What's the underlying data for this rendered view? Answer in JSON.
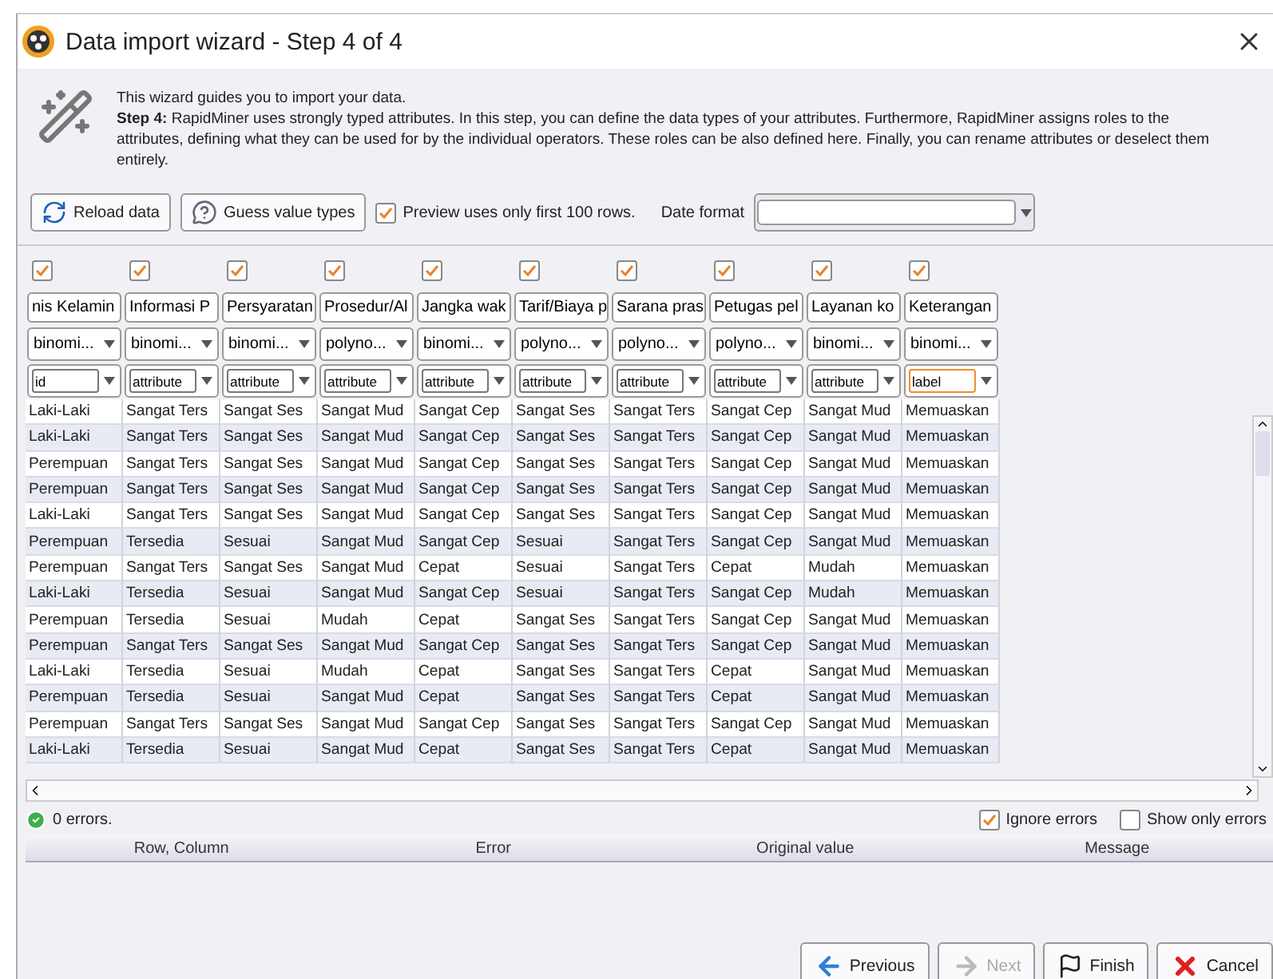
{
  "window": {
    "title": "Data import wizard - Step 4 of 4"
  },
  "intro": [
    "This wizard guides you to import your data.",
    "**Step 4:** RapidMiner uses strongly typed attributes. In this step, you can define the data types of your attributes. Furthermore, RapidMiner assigns roles to the attributes, defining what they can be used for by the individual operators. These roles can be also defined here. Finally, you can rename attributes or deselect them entirely."
  ],
  "toolbar": {
    "buttons": [
      {
        "label": "Reload data",
        "kind": "reload"
      },
      {
        "label": "Guess value types",
        "kind": "guess"
      }
    ],
    "preview": {
      "label": "Preview uses only first 100 rows.",
      "checked": true
    },
    "date_format": {
      "label": "Date format"
    }
  },
  "columns": [
    {
      "checked": true,
      "name": "nis Kelamin",
      "type": "binomi...",
      "role": "id",
      "focused": false
    },
    {
      "checked": true,
      "name": "Informasi  P",
      "type": "binomi...",
      "role": "attribute",
      "focused": false
    },
    {
      "checked": true,
      "name": "Persyaratan",
      "type": "binomi...",
      "role": "attribute",
      "focused": false
    },
    {
      "checked": true,
      "name": "Prosedur/Al",
      "type": "polyno...",
      "role": "attribute",
      "focused": false
    },
    {
      "checked": true,
      "name": "Jangka wak",
      "type": "binomi...",
      "role": "attribute",
      "focused": false
    },
    {
      "checked": true,
      "name": "Tarif/Biaya p",
      "type": "polyno...",
      "role": "attribute",
      "focused": false
    },
    {
      "checked": true,
      "name": "Sarana pras",
      "type": "polyno...",
      "role": "attribute",
      "focused": false
    },
    {
      "checked": true,
      "name": "Petugas pel",
      "type": "polyno...",
      "role": "attribute",
      "focused": false
    },
    {
      "checked": true,
      "name": "Layanan ko",
      "type": "binomi...",
      "role": "attribute",
      "focused": false
    },
    {
      "checked": true,
      "name": "Keterangan",
      "type": "binomi...",
      "role": "label",
      "focused": true
    }
  ],
  "rows": [
    [
      "Laki-Laki",
      "Sangat Ters",
      "Sangat Ses",
      "Sangat Mud",
      "Sangat Cep",
      "Sangat Ses",
      "Sangat Ters",
      "Sangat Cep",
      "Sangat Mud",
      "Memuaskan"
    ],
    [
      "Laki-Laki",
      "Sangat Ters",
      "Sangat Ses",
      "Sangat Mud",
      "Sangat Cep",
      "Sangat Ses",
      "Sangat Ters",
      "Sangat Cep",
      "Sangat Mud",
      "Memuaskan"
    ],
    [
      "Perempuan",
      "Sangat Ters",
      "Sangat Ses",
      "Sangat Mud",
      "Sangat Cep",
      "Sangat Ses",
      "Sangat Ters",
      "Sangat Cep",
      "Sangat Mud",
      "Memuaskan"
    ],
    [
      "Perempuan",
      "Sangat Ters",
      "Sangat Ses",
      "Sangat Mud",
      "Sangat Cep",
      "Sangat Ses",
      "Sangat Ters",
      "Sangat Cep",
      "Sangat Mud",
      "Memuaskan"
    ],
    [
      "Laki-Laki",
      "Sangat Ters",
      "Sangat Ses",
      "Sangat Mud",
      "Sangat Cep",
      "Sangat Ses",
      "Sangat Ters",
      "Sangat Cep",
      "Sangat Mud",
      "Memuaskan"
    ],
    [
      "Perempuan",
      "Tersedia",
      "Sesuai",
      "Sangat Mud",
      "Sangat Cep",
      "Sesuai",
      "Sangat Ters",
      "Sangat Cep",
      "Sangat Mud",
      "Memuaskan"
    ],
    [
      "Perempuan",
      "Sangat Ters",
      "Sangat Ses",
      "Sangat Mud",
      "Cepat",
      "Sesuai",
      "Sangat Ters",
      "Cepat",
      "Mudah",
      "Memuaskan"
    ],
    [
      "Laki-Laki",
      "Tersedia",
      "Sesuai",
      "Sangat Mud",
      "Sangat Cep",
      "Sesuai",
      "Sangat Ters",
      "Sangat Cep",
      "Mudah",
      "Memuaskan"
    ],
    [
      "Perempuan",
      "Tersedia",
      "Sesuai",
      "Mudah",
      "Cepat",
      "Sangat Ses",
      "Sangat Ters",
      "Sangat Cep",
      "Sangat Mud",
      "Memuaskan"
    ],
    [
      "Perempuan",
      "Sangat Ters",
      "Sangat Ses",
      "Sangat Mud",
      "Sangat Cep",
      "Sangat Ses",
      "Sangat Ters",
      "Sangat Cep",
      "Sangat Mud",
      "Memuaskan"
    ],
    [
      "Laki-Laki",
      "Tersedia",
      "Sesuai",
      "Mudah",
      "Cepat",
      "Sangat Ses",
      "Sangat Ters",
      "Cepat",
      "Sangat Mud",
      "Memuaskan"
    ],
    [
      "Perempuan",
      "Tersedia",
      "Sesuai",
      "Sangat Mud",
      "Cepat",
      "Sangat Ses",
      "Sangat Ters",
      "Cepat",
      "Sangat Mud",
      "Memuaskan"
    ],
    [
      "Perempuan",
      "Sangat Ters",
      "Sangat Ses",
      "Sangat Mud",
      "Sangat Cep",
      "Sangat Ses",
      "Sangat Ters",
      "Sangat Cep",
      "Sangat Mud",
      "Memuaskan"
    ],
    [
      "Laki-Laki",
      "Tersedia",
      "Sesuai",
      "Sangat Mud",
      "Cepat",
      "Sangat Ses",
      "Sangat Ters",
      "Cepat",
      "Sangat Mud",
      "Memuaskan"
    ]
  ],
  "status": {
    "errors": "0 errors.",
    "options": [
      {
        "label": "Ignore errors",
        "checked": true
      },
      {
        "label": "Show only errors",
        "checked": false
      }
    ]
  },
  "error_table": {
    "columns": [
      "Row, Column",
      "Error",
      "Original value",
      "Message"
    ]
  },
  "buttons": [
    {
      "label": "Previous",
      "kind": "previous",
      "disabled": false
    },
    {
      "label": "Next",
      "kind": "next",
      "disabled": true
    },
    {
      "label": "Finish",
      "kind": "finish",
      "disabled": false
    },
    {
      "label": "Cancel",
      "kind": "cancel",
      "disabled": false
    }
  ]
}
